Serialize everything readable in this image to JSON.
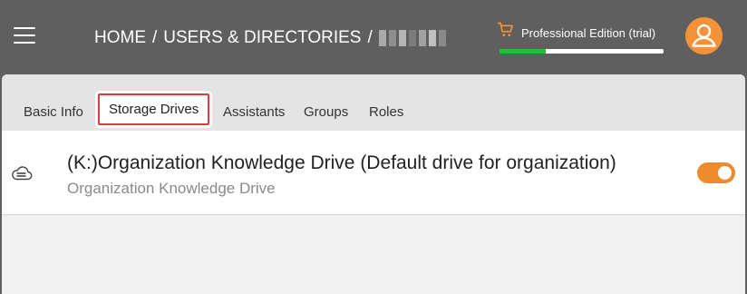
{
  "header": {
    "breadcrumb": [
      {
        "label": "HOME"
      },
      {
        "label": "USERS & DIRECTORIES"
      }
    ],
    "separator": "/",
    "edition_label": "Professional Edition (trial)",
    "trial_progress_percent": 28,
    "colors": {
      "topbar": "#5f5f5f",
      "progress": "#22c22a",
      "cart": "#f39237",
      "avatar": "#f39237"
    }
  },
  "tabs": [
    {
      "label": "Basic Info",
      "active": false
    },
    {
      "label": "Storage Drives",
      "active": true
    },
    {
      "label": "Assistants",
      "active": false
    },
    {
      "label": "Groups",
      "active": false
    },
    {
      "label": "Roles",
      "active": false
    }
  ],
  "drives": [
    {
      "icon": "cloud-storage-icon",
      "title": "(K:)Organization Knowledge Drive (Default drive for organization)",
      "subtitle": "Organization Knowledge Drive",
      "enabled": true
    }
  ],
  "accent": "#f08a2c"
}
